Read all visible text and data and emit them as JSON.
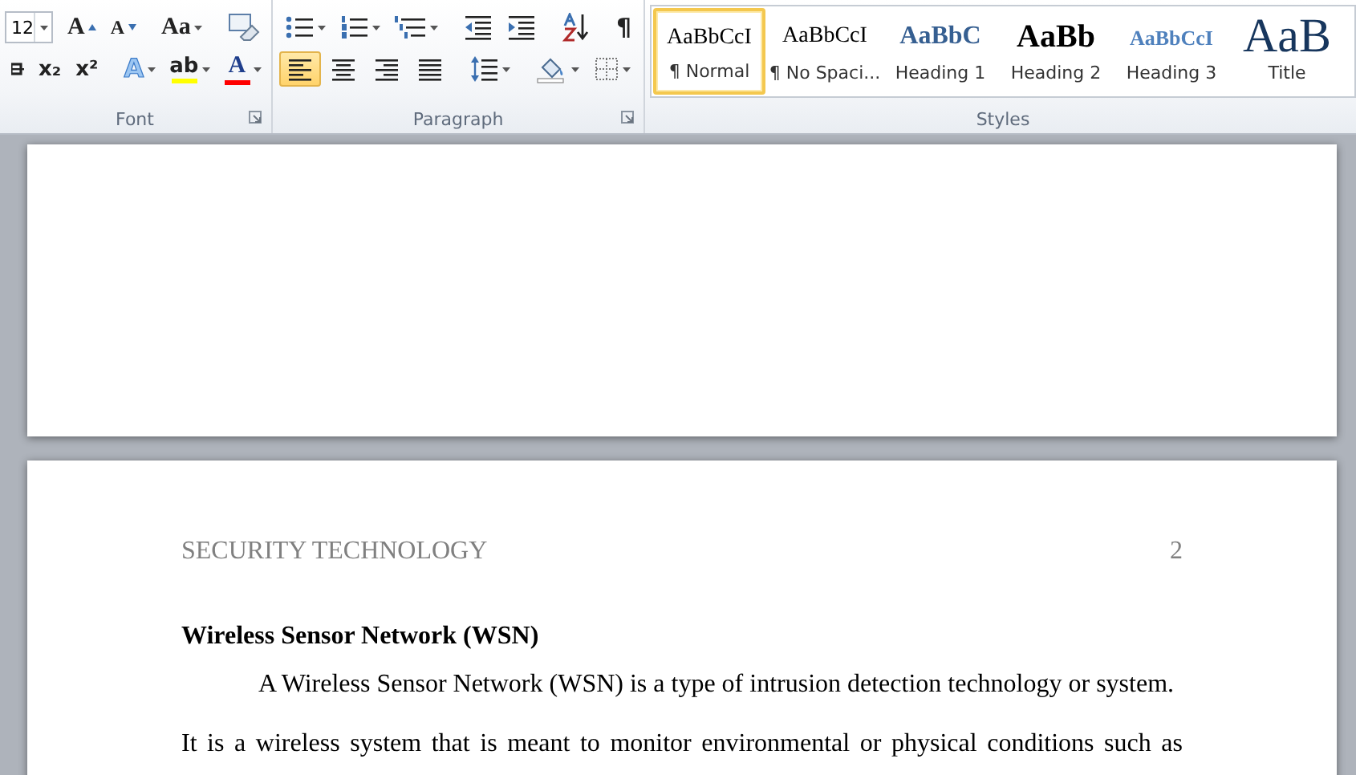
{
  "ribbon": {
    "groups": [
      {
        "kind": "font",
        "label": "Font",
        "font_size": "12",
        "rows": [
          [
            {
              "kind": "grow",
              "text": "A"
            },
            {
              "kind": "shrink",
              "text": "A"
            },
            {
              "kind": "sep"
            },
            {
              "kind": "case",
              "text": "Aa",
              "dropdown": true
            },
            {
              "kind": "sep"
            },
            {
              "kind": "clear"
            }
          ],
          [
            {
              "kind": "strike"
            },
            {
              "kind": "sub",
              "text": "x₂"
            },
            {
              "kind": "sup",
              "text": "x²"
            },
            {
              "kind": "sep"
            },
            {
              "kind": "effects",
              "text": "A",
              "dropdown": true
            },
            {
              "kind": "highlight",
              "text": "ab",
              "color": "#ffff00",
              "dropdown": true
            },
            {
              "kind": "fontcolor",
              "text": "A",
              "color": "#ff0000",
              "dropdown": true
            }
          ]
        ]
      },
      {
        "kind": "paragraph",
        "label": "Paragraph",
        "rows": [
          [
            {
              "kind": "bullets",
              "dropdown": true
            },
            {
              "kind": "numbering",
              "dropdown": true
            },
            {
              "kind": "multilevel",
              "dropdown": true
            },
            {
              "kind": "sep"
            },
            {
              "kind": "outdent"
            },
            {
              "kind": "indent"
            },
            {
              "kind": "sep"
            },
            {
              "kind": "sort"
            },
            {
              "kind": "sep"
            },
            {
              "kind": "pilcrow",
              "text": "¶"
            }
          ],
          [
            {
              "kind": "align_left",
              "selected": true
            },
            {
              "kind": "align_center",
              "selected": false
            },
            {
              "kind": "align_right",
              "selected": false
            },
            {
              "kind": "justify",
              "selected": false
            },
            {
              "kind": "sep"
            },
            {
              "kind": "spacing",
              "dropdown": true
            },
            {
              "kind": "sep"
            },
            {
              "kind": "shading",
              "dropdown": true
            },
            {
              "kind": "borders",
              "dropdown": true
            }
          ]
        ]
      },
      {
        "kind": "styles",
        "label": "Styles",
        "styles": [
          {
            "kind": "normal",
            "preview": "AaBbCcI",
            "name": "¶ Normal",
            "selected": true
          },
          {
            "kind": "normal",
            "preview": "AaBbCcI",
            "name": "¶ No Spaci...",
            "selected": false
          },
          {
            "kind": "heading1",
            "preview": "AaBbC",
            "name": "Heading 1",
            "selected": false
          },
          {
            "kind": "heading2",
            "preview": "AaBb",
            "name": "Heading 2",
            "selected": false
          },
          {
            "kind": "heading3",
            "preview": "AaBbCcI",
            "name": "Heading 3",
            "selected": false
          },
          {
            "kind": "title",
            "preview": "AaB",
            "name": "Title",
            "selected": false
          }
        ]
      }
    ]
  },
  "document": {
    "pages": [
      {
        "kind": "blank"
      },
      {
        "kind": "text",
        "header": {
          "title": "SECURITY TECHNOLOGY",
          "page_number": "2"
        },
        "blocks": [
          {
            "kind": "heading",
            "text": "Wireless Sensor Network (WSN)"
          },
          {
            "kind": "indented",
            "text": "A Wireless Sensor Network (WSN) is a type of intrusion detection technology or system."
          },
          {
            "kind": "justified",
            "text": "It is a wireless system that is meant to monitor environmental or physical conditions such as"
          }
        ]
      }
    ]
  }
}
